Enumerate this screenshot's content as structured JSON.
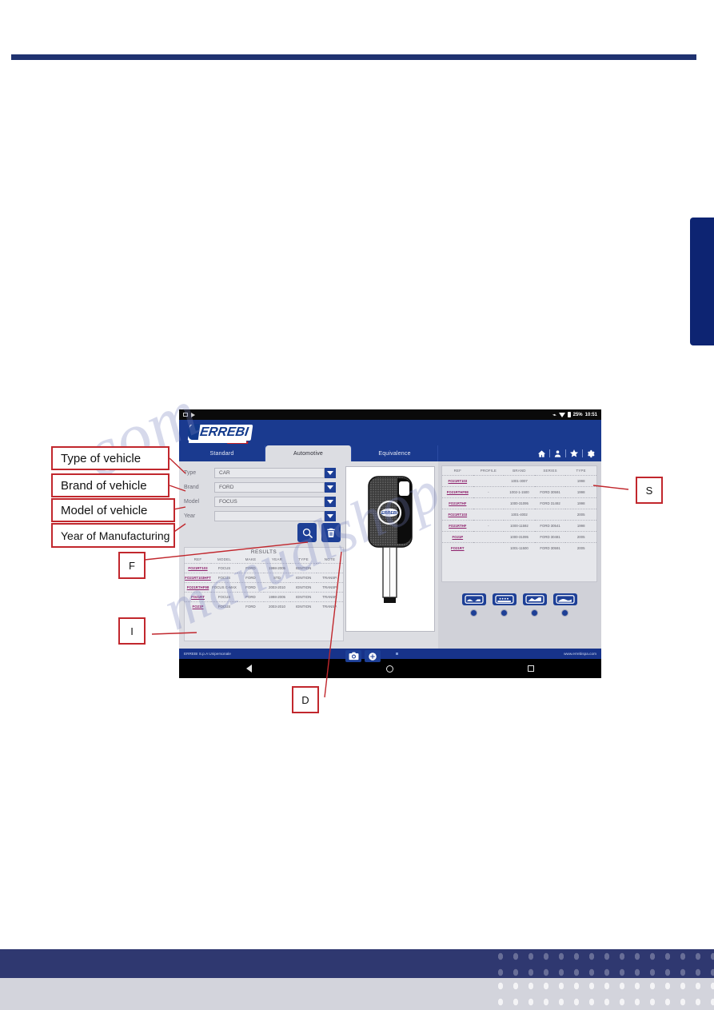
{
  "tablet": {
    "status_bar": {
      "battery": "25%",
      "time": "10:51",
      "icons": [
        "sim-icon",
        "cast-icon",
        "bluetooth-icon",
        "wifi-icon",
        "battery-icon"
      ]
    },
    "logo_text": "ERREBI",
    "tabs": [
      {
        "label": "Standard",
        "active": false
      },
      {
        "label": "Automotive",
        "active": true
      },
      {
        "label": "Equivalence",
        "active": false
      }
    ],
    "header_icons": [
      "home-icon",
      "user-icon",
      "star-icon",
      "gear-icon"
    ],
    "form": {
      "fields": [
        {
          "label": "Type",
          "value": "CAR"
        },
        {
          "label": "Brand",
          "value": "FORD"
        },
        {
          "label": "Model",
          "value": "FOCUS"
        },
        {
          "label": "Year",
          "value": ""
        }
      ],
      "search_button": "search-icon",
      "delete_button": "trash-icon"
    },
    "results": {
      "title": "RESULTS",
      "columns": [
        "REF",
        "MODEL",
        "MAKE",
        "YEAR",
        "TYPE",
        "NOTE"
      ],
      "rows": [
        [
          "FO21RT103",
          "FOCUS",
          "FORD",
          "1998-2005",
          "IGNITION",
          ""
        ],
        [
          "FO21RT103HFT",
          "FOCUS",
          "FORD",
          "STD",
          "IGNITION",
          "TRANSP."
        ],
        [
          "FO21RTHF98",
          "FOCUS C-MAX",
          "FORD",
          "2003-2010",
          "IGNITION",
          "TRANSP."
        ],
        [
          "FO21RT",
          "FOCUS",
          "FORD",
          "1998-2005",
          "IGNITION",
          "TRANSP."
        ],
        [
          "FO21P",
          "FOCUS",
          "FORD",
          "2003-2010",
          "IGNITION",
          "TRANSP."
        ]
      ]
    },
    "key_panel": {
      "camera_button": "camera-icon",
      "add_button": "plus-icon",
      "key_logo": "ERREBI"
    },
    "side_table": {
      "columns": [
        "REF",
        "PROFILE",
        "BRAND",
        "SERIES",
        "TYPE"
      ],
      "rows": [
        [
          "FO21RT103",
          "",
          "1001-3007",
          "",
          "1998"
        ],
        [
          "FO21RTHF98",
          "-",
          "1002-1-1500",
          "FORD 30591",
          "1998"
        ],
        [
          "FO21RTHF",
          "",
          "1000-31095",
          "FORD 31492",
          "1998"
        ],
        [
          "FO21RT103",
          "",
          "1001-4002",
          "",
          "2005"
        ],
        [
          "FO21RTHF",
          "-",
          "1000-11592",
          "FORD 30541",
          "1998"
        ],
        [
          "FO21P",
          "",
          "1000-31095",
          "FORD 30481",
          "2005"
        ],
        [
          "FO21RT",
          "",
          "1001-11500",
          "FORD 30591",
          "2005"
        ]
      ]
    },
    "profile_icons": [
      "key-profile-1",
      "key-profile-2",
      "key-profile-3",
      "key-profile-4"
    ],
    "footer": {
      "company": "ERREBI S.p.A Unipersonale",
      "website": "www.errebispa.com"
    },
    "nav_bar": [
      "back-icon",
      "home-icon",
      "recents-icon"
    ]
  },
  "callouts": {
    "type_of_vehicle": "Type of vehicle",
    "brand_of_vehicle": "Brand of vehicle",
    "model_of_vehicle": "Model of vehicle",
    "year_of_manufacturing": "Year of Manufacturing",
    "letter_f": "F",
    "letter_i": "I",
    "letter_s": "S",
    "letter_d": "D"
  },
  "watermark": {
    "line1": ".com",
    "line2": "manualshop"
  },
  "colors": {
    "brand_blue": "#1a3a8f",
    "deep_blue": "#0d2472",
    "accent_red": "#c1272d",
    "panel_grey": "#dcdde2",
    "ref_magenta": "#8d1f6b"
  }
}
